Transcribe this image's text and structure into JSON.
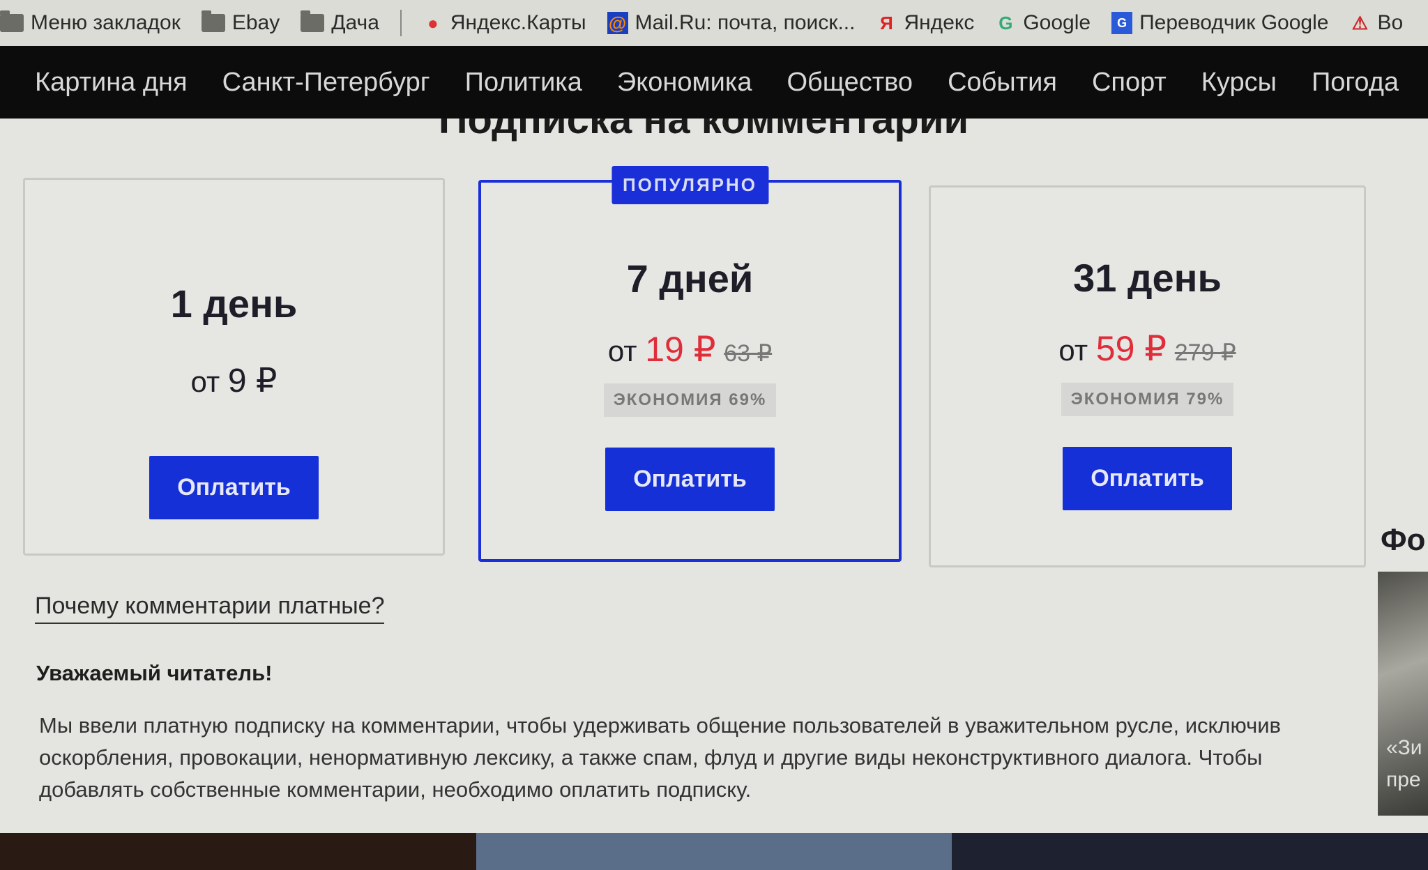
{
  "bookmarks": [
    {
      "label": "Меню закладок",
      "icon": "folder-icon"
    },
    {
      "label": "Ebay",
      "icon": "folder-icon"
    },
    {
      "label": "Дача",
      "icon": "folder-icon"
    },
    {
      "label": "Яндекс.Карты",
      "icon": "map-pin-icon"
    },
    {
      "label": "Mail.Ru: почта, поиск...",
      "icon": "mailru-icon"
    },
    {
      "label": "Яндекс",
      "icon": "yandex-icon"
    },
    {
      "label": "Google",
      "icon": "google-icon"
    },
    {
      "label": "Переводчик Google",
      "icon": "translate-icon"
    },
    {
      "label": "Во",
      "icon": "warning-icon"
    }
  ],
  "nav": [
    "Картина дня",
    "Санкт-Петербург",
    "Политика",
    "Экономика",
    "Общество",
    "События",
    "Спорт",
    "Курсы",
    "Погода"
  ],
  "page_title": "Подписка на комментарии",
  "plans": [
    {
      "duration": "1 день",
      "from": "от",
      "price": "9 ₽",
      "button": "Оплатить"
    },
    {
      "badge": "ПОПУЛЯРНО",
      "duration": "7 дней",
      "from": "от",
      "price": "19 ₽",
      "old_price": "63 ₽",
      "saving": "ЭКОНОМИЯ 69%",
      "button": "Оплатить"
    },
    {
      "duration": "31 день",
      "from": "от",
      "price": "59 ₽",
      "old_price": "279 ₽",
      "saving": "ЭКОНОМИЯ 79%",
      "button": "Оплатить"
    }
  ],
  "why_link": "Почему комментарии платные?",
  "greeting": "Уважаемый читатель!",
  "paragraph": "Мы ввели платную подписку на комментарии, чтобы удерживать общение пользователей в уважительном русле, исключив оскорбления, провокации, ненормативную лексику, а также спам, флуд и другие виды неконструктивного диалога. Чтобы добавлять собственные комментарии, необходимо оплатить подписку.",
  "sidebar": {
    "title": "Фо",
    "caption_1": "«Зи",
    "caption_2": "пре"
  },
  "colors": {
    "accent": "#1b2fd8",
    "price": "#e02d3a",
    "nav_bg": "#0c0c0c"
  }
}
